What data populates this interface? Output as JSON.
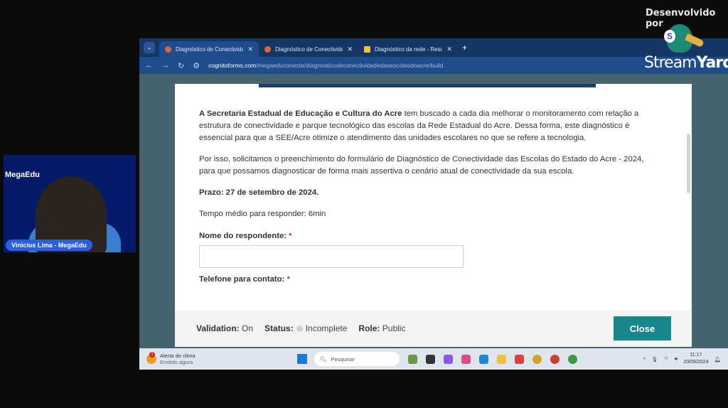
{
  "overlay": {
    "credit": "Desenvolvido por",
    "logo_text_light": "Stream",
    "logo_text_bold": "Yard",
    "logo_badge": "S"
  },
  "browser": {
    "tabs": [
      {
        "title": "Diagnóstico de Conectividade",
        "active": true
      },
      {
        "title": "Diagnóstico de Conectividade",
        "active": false
      },
      {
        "title": "Diagnóstico da rede - Resumido",
        "active": false
      }
    ],
    "url_domain": "cognitoforms.com",
    "url_path": "/megaeduconecta/diagnosticodeconectividadedasescolasdoacre/build"
  },
  "modal": {
    "intro_bold": "A Secretaria Estadual de Educação e Cultura do Acre",
    "intro_rest": " tem buscado a cada dia melhorar o monitoramento com relação a estrutura de conectividade e parque tecnológico das escolas da Rede Estadual do Acre. Dessa forma, este diagnóstico é essencial para que a SEE/Acre otimize o atendimento das unidades escolares no que se refere a tecnologia.",
    "paragraph2": "Por isso, solicitamos o preenchimento do formulário de Diagnóstico de Conectividade das Escolas do Estado do Acre - 2024, para que possamos diagnosticar de forma mais assertiva o cenário atual de conectividade da sua escola.",
    "deadline": "Prazo: 27 de setembro de 2024.",
    "avg_time": "Tempo médio para responder: 6min",
    "field1_label": "Nome do respondente:",
    "field1_value": "",
    "field2_label": "Telefone para contato:",
    "required_mark": "*",
    "footer": {
      "validation_label": "Validation:",
      "validation_value": "On",
      "status_label": "Status:",
      "status_value": "Incomplete",
      "role_label": "Role:",
      "role_value": "Public",
      "close_label": "Close"
    },
    "accent": "#17878b"
  },
  "taskbar": {
    "weather_title": "Alerta de clima",
    "weather_sub": "Emitido agora",
    "weather_badge": "1",
    "search_placeholder": "Pesquisar",
    "time": "11:17",
    "date": "20/09/2024"
  },
  "webcam": {
    "name": "Vinicius Lima - MegaEdu",
    "logo": "MegaEdu"
  }
}
